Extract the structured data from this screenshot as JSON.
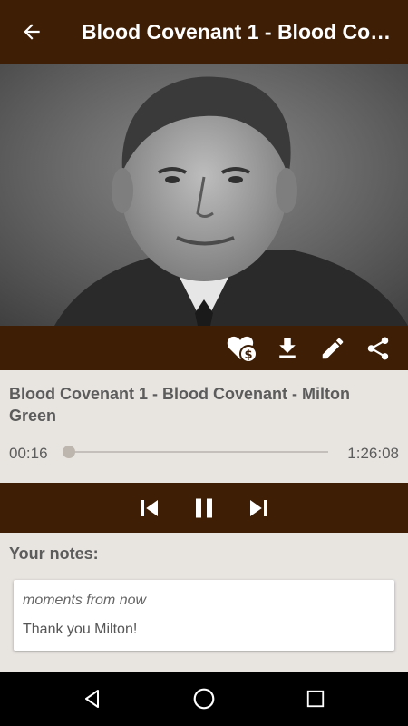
{
  "appbar": {
    "title": "Blood Covenant 1 - Blood Covenant - Milton Green",
    "back_icon": "arrow-left-icon"
  },
  "hero": {
    "image": "speaker-portrait"
  },
  "actions": [
    {
      "name": "donate-heart-icon"
    },
    {
      "name": "download-icon"
    },
    {
      "name": "edit-icon"
    },
    {
      "name": "share-icon"
    }
  ],
  "player": {
    "track_title": "Blood Covenant 1 - Blood Covenant - Milton Green",
    "current_time": "00:16",
    "total_time": "1:26:08",
    "progress_fraction": 0.003
  },
  "controls": {
    "previous": "skip-previous-icon",
    "pause": "pause-icon",
    "next": "skip-next-icon"
  },
  "notes": {
    "label": "Your notes:",
    "items": [
      {
        "time": "moments from now",
        "text": "Thank you Milton!"
      }
    ]
  },
  "colors": {
    "brand": "#3e1e05",
    "background": "#e8e5e1",
    "text": "#5c5c5c"
  }
}
